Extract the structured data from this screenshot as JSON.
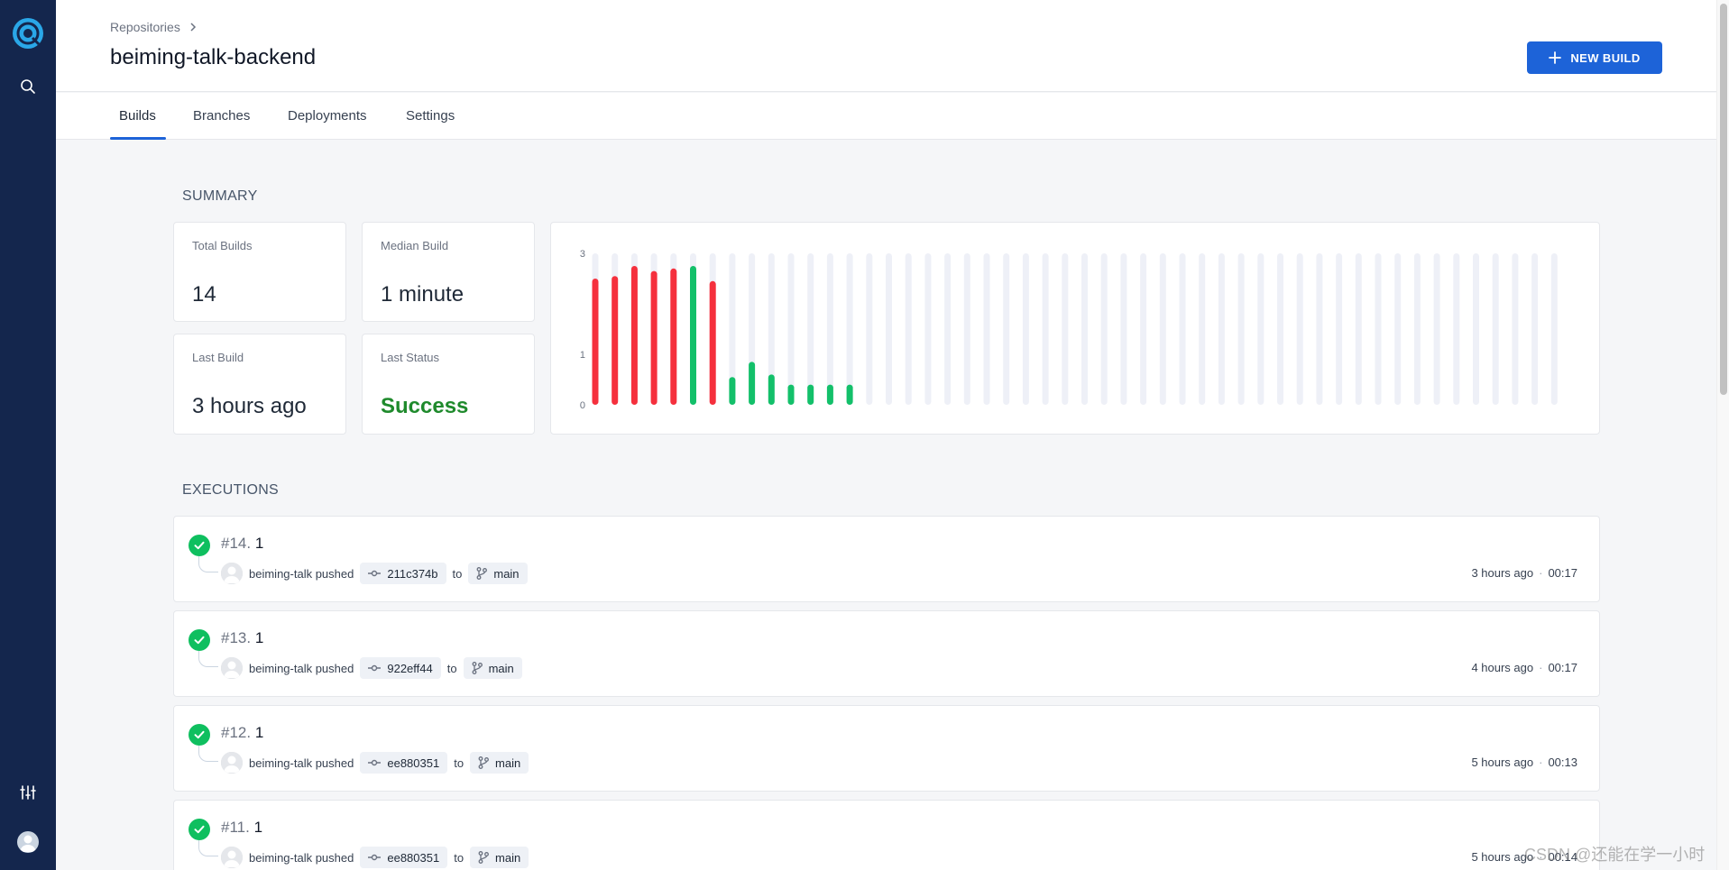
{
  "sidebar": {
    "logo_icon": "drone-logo-icon",
    "search_icon": "search-icon",
    "settings_icon": "sliders-icon",
    "avatar_icon": "user-avatar-icon"
  },
  "header": {
    "breadcrumb": "Repositories",
    "title": "beiming-talk-backend",
    "new_build_label": "NEW BUILD"
  },
  "tabs": [
    "Builds",
    "Branches",
    "Deployments",
    "Settings"
  ],
  "active_tab": "Builds",
  "summary": {
    "heading": "SUMMARY",
    "total_builds_label": "Total Builds",
    "total_builds": "14",
    "median_build_label": "Median Build",
    "median_build": "1 minute",
    "last_build_label": "Last Build",
    "last_build": "3 hours ago",
    "last_status_label": "Last Status",
    "last_status": "Success"
  },
  "chart_data": {
    "type": "bar",
    "ylim": [
      0,
      3
    ],
    "yticks": [
      "0",
      "1",
      "3"
    ],
    "slots": 50,
    "bars": [
      {
        "value": 2.5,
        "status": "failure"
      },
      {
        "value": 2.55,
        "status": "failure"
      },
      {
        "value": 2.75,
        "status": "failure"
      },
      {
        "value": 2.65,
        "status": "failure"
      },
      {
        "value": 2.7,
        "status": "failure"
      },
      {
        "value": 2.75,
        "status": "success"
      },
      {
        "value": 2.45,
        "status": "failure"
      },
      {
        "value": 0.55,
        "status": "success"
      },
      {
        "value": 0.85,
        "status": "success"
      },
      {
        "value": 0.6,
        "status": "success"
      },
      {
        "value": 0.4,
        "status": "success"
      },
      {
        "value": 0.4,
        "status": "success"
      },
      {
        "value": 0.4,
        "status": "success"
      },
      {
        "value": 0.4,
        "status": "success"
      }
    ],
    "colors": {
      "success": "#13c06a",
      "failure": "#f5303d",
      "empty": "#eef0f7"
    }
  },
  "executions": {
    "heading": "EXECUTIONS",
    "items": [
      {
        "number": "#14.",
        "message": "1",
        "author": "beiming-talk pushed",
        "commit": "211c374b",
        "to": "to",
        "branch": "main",
        "time": "3 hours ago",
        "duration": "00:17"
      },
      {
        "number": "#13.",
        "message": "1",
        "author": "beiming-talk pushed",
        "commit": "922eff44",
        "to": "to",
        "branch": "main",
        "time": "4 hours ago",
        "duration": "00:17"
      },
      {
        "number": "#12.",
        "message": "1",
        "author": "beiming-talk pushed",
        "commit": "ee880351",
        "to": "to",
        "branch": "main",
        "time": "5 hours ago",
        "duration": "00:13"
      },
      {
        "number": "#11.",
        "message": "1",
        "author": "beiming-talk pushed",
        "commit": "ee880351",
        "to": "to",
        "branch": "main",
        "time": "5 hours ago",
        "duration": "00:14"
      }
    ]
  },
  "watermark": "CSDN @还能在学一小时"
}
